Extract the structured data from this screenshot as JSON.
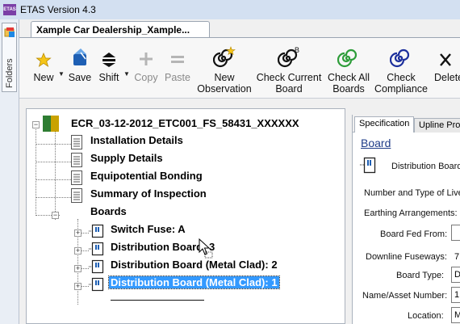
{
  "window": {
    "title": "ETAS Version 4.3",
    "logo_text": "ETAS"
  },
  "sidebar": {
    "folders_label": "Folders"
  },
  "document_tab": {
    "label": "Xample Car Dealership_Xample..."
  },
  "toolbar": {
    "new_label": "New",
    "save_label": "Save",
    "shift_label": "Shift",
    "copy_label": "Copy",
    "paste_label": "Paste",
    "new_observation_line1": "New",
    "new_observation_line2": "Observation",
    "check_current_board_line1": "Check Current",
    "check_current_board_line2": "Board",
    "check_all_boards_line1": "Check All",
    "check_all_boards_line2": "Boards",
    "check_compliance_line1": "Check",
    "check_compliance_line2": "Compliance",
    "delete_label": "Delete"
  },
  "tree": {
    "root": "ECR_03-12-2012_ETC001_FS_58431_XXXXXX",
    "items": [
      "Installation Details",
      "Supply Details",
      "Equipotential Bonding",
      "Summary of Inspection",
      "Boards"
    ],
    "boards": [
      "Switch Fuse: A",
      "Distribution Board: 3",
      "Distribution Board (Metal Clad): 2",
      "Distribution Board (Metal Clad): 1"
    ]
  },
  "properties": {
    "tab_specification": "Specification",
    "tab_upline": "Upline Protection",
    "heading": "Board",
    "board_type_display": "Distribution Board",
    "number_and_type": "Number and Type of Live",
    "earthing_arrangements": "Earthing Arrangements:",
    "board_fed_from": "Board Fed From:",
    "downline_fuseways": "Downline Fuseways:",
    "downline_fuseways_value": "7",
    "board_type_label": "Board Type:",
    "board_type_value": "D",
    "name_asset_number": "Name/Asset Number:",
    "name_asset_value": "1",
    "location_label": "Location:",
    "location_value": "M"
  },
  "colors": {
    "selection": "#3399ff",
    "titlebar": "#d3e0f1",
    "root_icon_green": "#2e7d32",
    "root_icon_gold": "#c9a200"
  }
}
